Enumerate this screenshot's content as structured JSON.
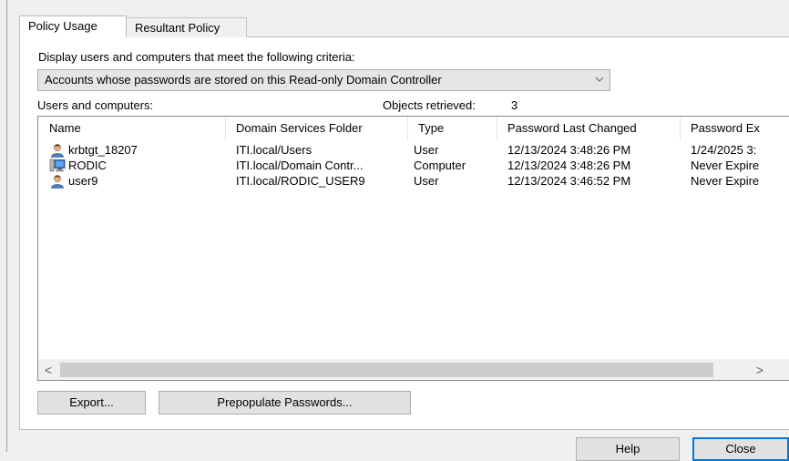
{
  "tabs": [
    {
      "label": "Policy Usage",
      "active": true
    },
    {
      "label": "Resultant Policy",
      "active": false
    }
  ],
  "criteria": {
    "label": "Display users and computers that meet the following criteria:",
    "selected": "Accounts whose passwords are stored on this Read-only Domain Controller",
    "icon": "chevron-down-icon"
  },
  "list": {
    "label": "Users and computers:",
    "retrieved_label": "Objects retrieved:",
    "retrieved_count": "3",
    "columns": [
      "Name",
      "Domain Services Folder",
      "Type",
      "Password Last Changed",
      "Password Ex"
    ],
    "rows": [
      {
        "icon": "user-icon",
        "name": "krbtgt_18207",
        "folder": "ITI.local/Users",
        "type": "User",
        "changed": "12/13/2024 3:48:26 PM",
        "expires": "1/24/2025 3:"
      },
      {
        "icon": "computer-icon",
        "name": "RODIC",
        "folder": "ITI.local/Domain Contr...",
        "type": "Computer",
        "changed": "12/13/2024 3:48:26 PM",
        "expires": "Never Expire"
      },
      {
        "icon": "user-icon",
        "name": "user9",
        "folder": "ITI.local/RODIC_USER9",
        "type": "User",
        "changed": "12/13/2024 3:46:52 PM",
        "expires": "Never Expire"
      }
    ]
  },
  "scrollbar": {
    "left_arrow": "<",
    "right_arrow": ">"
  },
  "buttons": {
    "export": "Export...",
    "prepopulate": "Prepopulate Passwords...",
    "help": "Help",
    "close": "Close"
  },
  "colors": {
    "focus_border": "#0078d7",
    "panel": "#ffffff",
    "window": "#f0f0f0"
  }
}
